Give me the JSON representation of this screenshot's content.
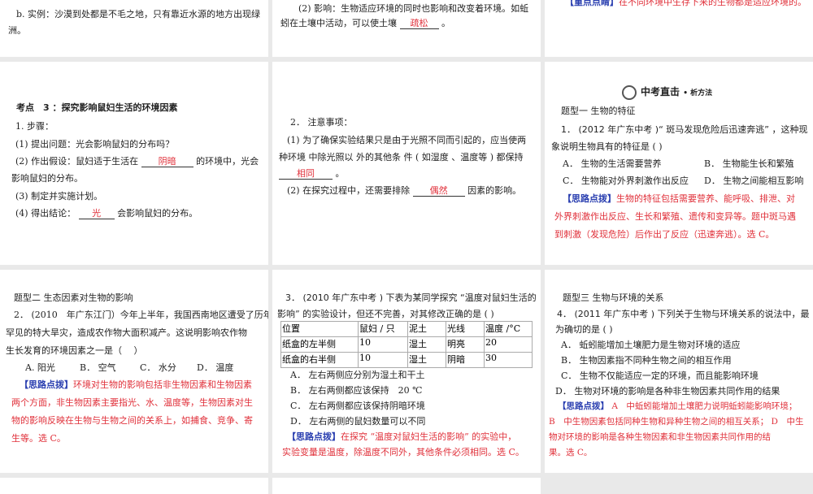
{
  "slide1": {
    "line_b": "b. 实例：沙漠到处都是不毛之地，只有靠近水源的地方出现绿",
    "line_b2": "洲。"
  },
  "slide2": {
    "l1": "(2) 影响：生物适应环境的同时也影响和改变着环境。如蚯",
    "l2a": "蚓在土壤中活动，可以使土壤",
    "blank": "疏松",
    "l2b": "。"
  },
  "slide3": {
    "label": "【重点点睛】",
    "text": "在不同环境中生存下来的生物都是适应环境的。"
  },
  "slide4": {
    "title": "考点　3 ：探究影响鼠妇生活的环境因素",
    "s1": "1. 步骤：",
    "s2": "(1) 提出问题：光会影响鼠妇的分布吗？",
    "s3a": "(2) 作出假设：鼠妇适于生活在",
    "blank1": "阴暗",
    "s3b": "的环境中，光会",
    "s3c": "影响鼠妇的分布。",
    "s4": "(3) 制定并实施计划。",
    "s5a": "(4) 得出结论：",
    "blank2": "光",
    "s5b": "会影响鼠妇的分布。"
  },
  "slide5": {
    "t": "2． 注意事项：",
    "l1": "(1) 为了确保实验结果只是由于光照不同而引起的，应当使两",
    "l2": "种环境 中除光照以 外的其他条 件 ( 如湿度 、温度等 ) 都保持",
    "blank1": "相同",
    "l3": "。",
    "l4a": "(2) 在探究过程中，还需要排除",
    "blank2": "偶然",
    "l4b": "因素的影响。"
  },
  "slide6": {
    "banner": "中考直击",
    "banner_sub": "• 析方法",
    "type": "题型一 生物的特征",
    "q1": "1． (2012 年广东中考 )“ 斑马发现危险后迅速奔逃” ，这种现",
    "q2": "象说明生物具有的特征是 ( )",
    "A": "A． 生物的生活需要营养",
    "B": "B． 生物能生长和繁殖",
    "C": "C． 生物能对外界刺激作出反应",
    "D": "D． 生物之间能相互影响",
    "label": "【思路点拨】",
    "e1": "生物的特征包括需要营养、能呼吸、排泄、对",
    "e2": "外界刺激作出反应、生长和繁殖、遗传和变异等。题中斑马遇",
    "e3": "到刺激（发现危险）后作出了反应（迅速奔逃）。选 C。"
  },
  "slide7": {
    "type": "题型二 生态因素对生物的影响",
    "q1": "2． (2010　年广东江门）今年上半年，我国西南地区遭受了历年",
    "q2": "罕见的特大旱灾，造成农作物大面积减产。这说明影响农作物",
    "q3": "生长发育的环境因素之一是（　 ）",
    "A": "A. 阳光",
    "B": "B． 空气",
    "C": "C． 水分",
    "D": "D． 温度",
    "label": "【思路点拨】",
    "e1": "环境对生物的影响包括非生物因素和生物因素",
    "e2": "两个方面，非生物因素主要指光、水、温度等，生物因素对生",
    "e3": "物的影响反映在生物与生物之间的关系上，如捕食、竞争、寄",
    "e4": "生等。选 C。"
  },
  "slide8": {
    "q1": "3． (2010 年广东中考 ) 下表为某同学探究 “温度对鼠妇生活的",
    "q2": "影响” 的实验设计，但还不完善，对其修改正确的是 ( )",
    "table": [
      [
        "位置",
        "鼠妇 / 只",
        "泥土",
        "光线",
        "温度 /°C"
      ],
      [
        "纸盒的左半侧",
        "10",
        "湿土",
        "明亮",
        "20"
      ],
      [
        "纸盒的右半侧",
        "10",
        "湿土",
        "阴暗",
        "30"
      ]
    ],
    "A": "A． 左右两侧应分别为湿土和干土",
    "B": "B． 左右两侧都应该保持　20 ℃",
    "C": "C． 左右两侧都应该保持阴暗环境",
    "D": "D． 左右两侧的鼠妇数量可以不同",
    "label": "【思路点拨】",
    "e1": "在探究 “温度对鼠妇生活的影响” 的实验中，",
    "e2": "实验变量是温度，除温度不同外，其他条件必须相同。选 C。"
  },
  "slide9": {
    "type": "题型三 生物与环境的关系",
    "q1": "4． (2011 年广东中考 ) 下列关于生物与环境关系的说法中，最",
    "q2": "为确切的是 ( )",
    "A": "A． 蚯蚓能增加土壤肥力是生物对环境的适应",
    "B": "B． 生物因素指不同种生物之间的相互作用",
    "C": "C． 生物不仅能适应一定的环境，而且能影响环境",
    "D": "D． 生物对环境的影响是各种非生物因素共同作用的结果",
    "label": "【思路点拨】",
    "e1": " A　中蚯蚓能增加土壤肥力说明蚯蚓能影响环境；",
    "e2": "B　中生物因素包括同种生物和异种生物之间的相互关系； D　中生",
    "e3": "物对环境的影响是各种生物因素和非生物因素共同作用的结",
    "e4": "果。选 C。"
  }
}
